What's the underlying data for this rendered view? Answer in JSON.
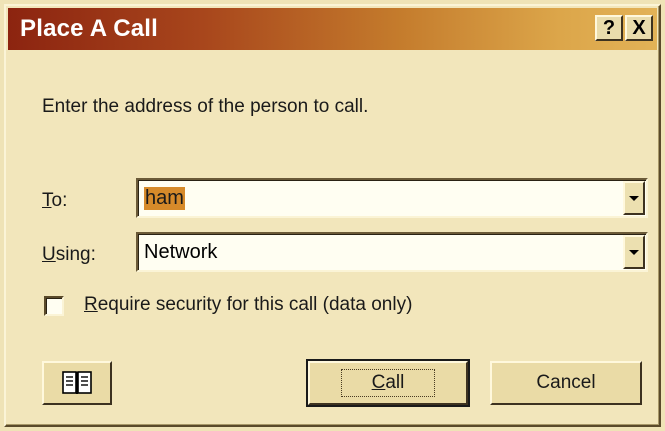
{
  "window": {
    "title": "Place A Call",
    "help_label": "?",
    "close_label": "X"
  },
  "instruction": "Enter the address of the person to call.",
  "to_field": {
    "label_mnemonic": "T",
    "label_rest": "o:",
    "value": "ham"
  },
  "using_field": {
    "label_mnemonic": "U",
    "label_rest": "sing:",
    "value": "Network"
  },
  "security_checkbox": {
    "label_mnemonic": "R",
    "label_rest": "equire security for this call (data only)",
    "checked": false
  },
  "buttons": {
    "address_book_icon": "address-book-icon",
    "call_mnemonic": "C",
    "call_rest": "all",
    "cancel_label": "Cancel"
  },
  "colors": {
    "title_start": "#8c2410",
    "title_end": "#e2b257",
    "dialog_bg": "#f2e6bb",
    "selection": "#d68a2a"
  }
}
